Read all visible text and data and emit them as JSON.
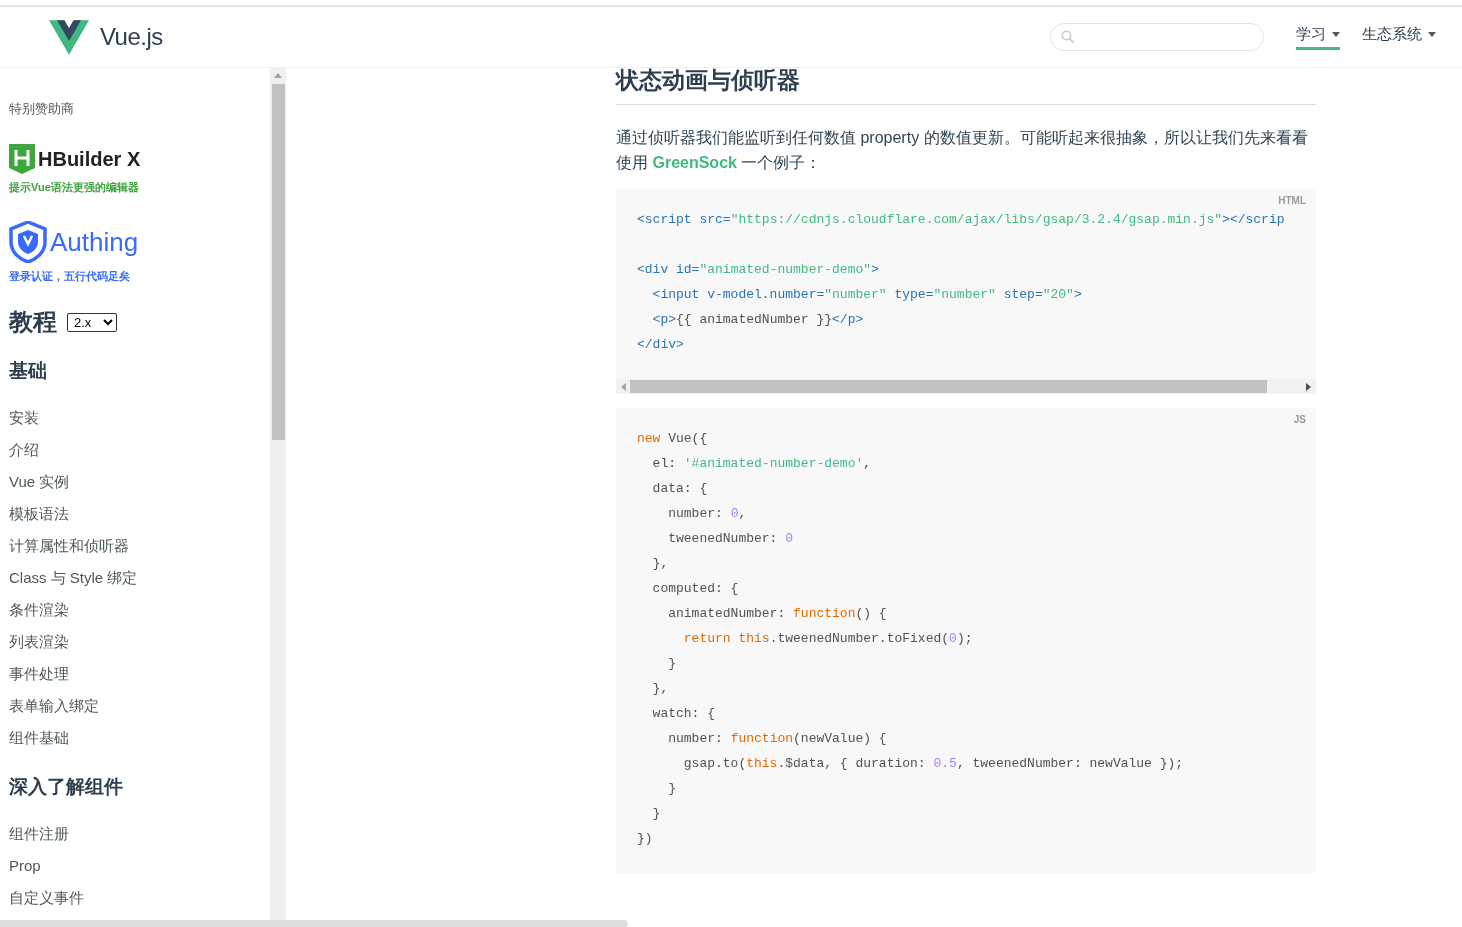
{
  "header": {
    "logo_text": "Vue.js",
    "nav": [
      {
        "label": "学习",
        "selected": true,
        "dropdown": true
      },
      {
        "label": "生态系统",
        "selected": false,
        "dropdown": true
      }
    ]
  },
  "sidebar": {
    "sponsor_heading": "特别赞助商",
    "sponsors": [
      {
        "kind": "hbuilder",
        "name": "HBuilder X",
        "tagline": "提示Vue语法更强的编辑器",
        "color": "#3fa53f"
      },
      {
        "kind": "authing",
        "name": "Authing",
        "tagline": "登录认证，五行代码足矣",
        "color": "#396aff"
      }
    ],
    "section_title": "教程",
    "version": "2.x",
    "groups": [
      {
        "title": "基础",
        "items": [
          "安装",
          "介绍",
          "Vue 实例",
          "模板语法",
          "计算属性和侦听器",
          "Class 与 Style 绑定",
          "条件渲染",
          "列表渲染",
          "事件处理",
          "表单输入绑定",
          "组件基础"
        ]
      },
      {
        "title": "深入了解组件",
        "items": [
          "组件注册",
          "Prop",
          "自定义事件"
        ]
      }
    ]
  },
  "content": {
    "title": "状态动画与侦听器",
    "paragraph": {
      "before": "通过侦听器我们能监听到任何数值 property 的数值更新。可能听起来很抽象，所以让我们先来看看使用 ",
      "link": "GreenSock",
      "after": " 一个例子："
    },
    "code_blocks": [
      {
        "lang": "HTML",
        "scrollable": true,
        "lines": [
          {
            "kind": "code",
            "tokens": [
              {
                "kind": "tag",
                "text": "<script src="
              },
              {
                "kind": "string",
                "text": "\"https://cdnjs.cloudflare.com/ajax/libs/gsap/3.2.4/gsap.min.js\""
              },
              {
                "kind": "tag",
                "text": "></scrip"
              }
            ]
          },
          {
            "kind": "blank"
          },
          {
            "kind": "code",
            "tokens": [
              {
                "kind": "tag",
                "text": "<div id="
              },
              {
                "kind": "string",
                "text": "\"animated-number-demo\""
              },
              {
                "kind": "tag",
                "text": ">"
              }
            ]
          },
          {
            "kind": "code",
            "tokens": [
              {
                "kind": "tag",
                "text": "  <input v-model.number="
              },
              {
                "kind": "string",
                "text": "\"number\""
              },
              {
                "kind": "tag",
                "text": " type="
              },
              {
                "kind": "string",
                "text": "\"number\""
              },
              {
                "kind": "tag",
                "text": " step="
              },
              {
                "kind": "string",
                "text": "\"20\""
              },
              {
                "kind": "tag",
                "text": ">"
              }
            ]
          },
          {
            "kind": "code",
            "tokens": [
              {
                "kind": "tag",
                "text": "  <p>"
              },
              {
                "kind": "plain",
                "text": "{{ animatedNumber }}"
              },
              {
                "kind": "tag",
                "text": "</p>"
              }
            ]
          },
          {
            "kind": "code",
            "tokens": [
              {
                "kind": "tag",
                "text": "</div>"
              }
            ]
          }
        ]
      },
      {
        "lang": "JS",
        "scrollable": false,
        "lines": [
          {
            "kind": "code",
            "tokens": [
              {
                "kind": "keyword",
                "text": "new"
              },
              {
                "kind": "plain",
                "text": " Vue({"
              }
            ]
          },
          {
            "kind": "code",
            "tokens": [
              {
                "kind": "plain",
                "text": "  el: "
              },
              {
                "kind": "string",
                "text": "'#animated-number-demo'"
              },
              {
                "kind": "plain",
                "text": ","
              }
            ]
          },
          {
            "kind": "code",
            "tokens": [
              {
                "kind": "plain",
                "text": "  data: {"
              }
            ]
          },
          {
            "kind": "code",
            "tokens": [
              {
                "kind": "plain",
                "text": "    number: "
              },
              {
                "kind": "number",
                "text": "0"
              },
              {
                "kind": "plain",
                "text": ","
              }
            ]
          },
          {
            "kind": "code",
            "tokens": [
              {
                "kind": "plain",
                "text": "    tweenedNumber: "
              },
              {
                "kind": "number",
                "text": "0"
              }
            ]
          },
          {
            "kind": "code",
            "tokens": [
              {
                "kind": "plain",
                "text": "  },"
              }
            ]
          },
          {
            "kind": "code",
            "tokens": [
              {
                "kind": "plain",
                "text": "  computed: {"
              }
            ]
          },
          {
            "kind": "code",
            "tokens": [
              {
                "kind": "plain",
                "text": "    animatedNumber: "
              },
              {
                "kind": "keyword",
                "text": "function"
              },
              {
                "kind": "plain",
                "text": "() {"
              }
            ]
          },
          {
            "kind": "code",
            "tokens": [
              {
                "kind": "keyword",
                "text": "      return this"
              },
              {
                "kind": "plain",
                "text": ".tweenedNumber.toFixed("
              },
              {
                "kind": "number",
                "text": "0"
              },
              {
                "kind": "plain",
                "text": ");"
              }
            ]
          },
          {
            "kind": "code",
            "tokens": [
              {
                "kind": "plain",
                "text": "    }"
              }
            ]
          },
          {
            "kind": "code",
            "tokens": [
              {
                "kind": "plain",
                "text": "  },"
              }
            ]
          },
          {
            "kind": "code",
            "tokens": [
              {
                "kind": "plain",
                "text": "  watch: {"
              }
            ]
          },
          {
            "kind": "code",
            "tokens": [
              {
                "kind": "plain",
                "text": "    number: "
              },
              {
                "kind": "keyword",
                "text": "function"
              },
              {
                "kind": "plain",
                "text": "(newValue) {"
              }
            ]
          },
          {
            "kind": "code",
            "tokens": [
              {
                "kind": "plain",
                "text": "      gsap.to("
              },
              {
                "kind": "keyword",
                "text": "this"
              },
              {
                "kind": "plain",
                "text": ".$data, { duration: "
              },
              {
                "kind": "number",
                "text": "0.5"
              },
              {
                "kind": "plain",
                "text": ", tweenedNumber: newValue });"
              }
            ]
          },
          {
            "kind": "code",
            "tokens": [
              {
                "kind": "plain",
                "text": "    }"
              }
            ]
          },
          {
            "kind": "code",
            "tokens": [
              {
                "kind": "plain",
                "text": "  }"
              }
            ]
          },
          {
            "kind": "code",
            "tokens": [
              {
                "kind": "plain",
                "text": "})"
              }
            ]
          }
        ]
      }
    ]
  }
}
